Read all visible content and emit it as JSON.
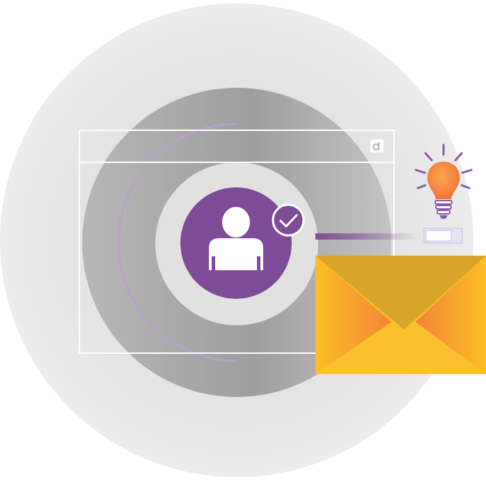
{
  "illustration": {
    "subject": "user-verification-email",
    "icons": [
      "browser-window-icon",
      "user-avatar-icon",
      "check-badge-icon",
      "lightbulb-icon",
      "envelope-icon",
      "toggle-switch-icon"
    ],
    "colors": {
      "accent_purple": "#7e4c96",
      "ring_light": "#e6e6e6",
      "ring_mid": "#b9b9b9",
      "envelope_body": "#fbbf24",
      "envelope_flap": "#d9a42a",
      "envelope_side": "#f39a2e",
      "bulb_orange": "#f5923e",
      "switch_fill": "#e6e2f3"
    }
  }
}
